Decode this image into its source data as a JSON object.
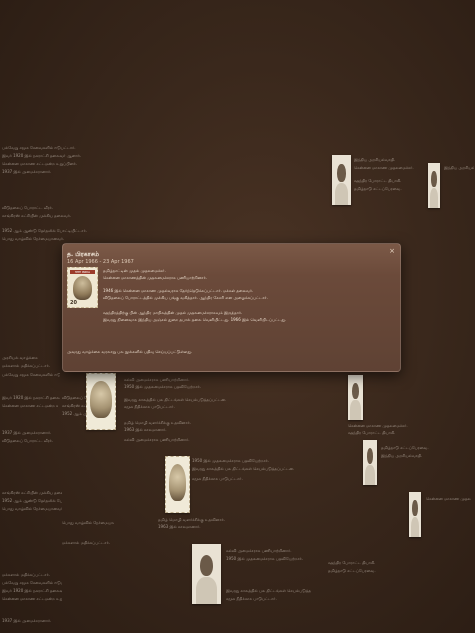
{
  "popup": {
    "title": "த. பிரகாசம்",
    "date": "16 Apr 1966 - 23 Apr 1967",
    "stamp_header": "भारत INDIA",
    "stamp_value": "20",
    "lines": [
      "தமிழ்நாட்டின் முதல் முதலமைச்சர்.",
      "சென்னை மாகாணத்தின் முதலமைச்சராக பணியாற்றினார்.",
      "1946 இல் சென்னை மாகாண முதல்வராக தேர்ந்தெடுக்கப்பட்டார். மக்கள் தலைவர்.",
      "விடுதலைப் போராட்டத்தில் முக்கிய பங்கு வகித்தார். ஆந்திர கேசரி என அழைக்கப்பட்டார்.",
      "சுதந்திரத்திற்கு பின் ஆந்திர மாநிலத்தின் முதல் முதலமைச்சராகவும் இருந்தார்.",
      "இவரது நினைவாக இந்திய அஞ்சல் துறை தபால் தலை வெளியிட்டது. 1966 இல் வெளியிடப்பட்டது.",
      "அவரது வாழ்க்கை வரலாறு பல நூல்களில் பதிவு செய்யப்பட்டுள்ளது."
    ]
  },
  "wall_text": {
    "left": [
      "பல்வேறு சமூக சேவைகளில் ஈடுபட்டார்.",
      "இவர் 1920 இல் நகராட்சி தலைவர் ஆனார்.",
      "சென்னை மாகாண சட்டமன்ற உறுப்பினர்.",
      "1937 இல் அமைச்சரானார்.",
      "விடுதலைப் போராட்ட வீரர்.",
      "காங்கிரஸ் கட்சியின் முக்கிய தலைவர்.",
      "1952 ஆம் ஆண்டு தேர்தலில் போட்டியிட்டார்.",
      "அரசியல் வாழ்க்கை",
      "பொது வாழ்வில் நேர்மையானவர்.",
      "மக்களால் மதிக்கப்பட்டார்."
    ],
    "mid": [
      "கல்வி அமைச்சராக பணியாற்றினார்.",
      "1950 இல் முதலமைச்சராக பதவியேற்றார்.",
      "இவரது காலத்தில் பல திட்டங்கள் செயல்படுத்தப்பட்டன.",
      "சமூக நீதிக்காக பாடுபட்டார்.",
      "தமிழ் மொழி வளர்ச்சிக்கு உதவினார்.",
      "1963 இல் காலமானார்."
    ],
    "right": [
      "இந்திய அரசியல்வாதி.",
      "சென்னை மாகாண முதலமைச்சர்.",
      "சுதந்திர போராட்ட தியாகி.",
      "தமிழ்நாடு சட்டப்பேரவை."
    ]
  }
}
